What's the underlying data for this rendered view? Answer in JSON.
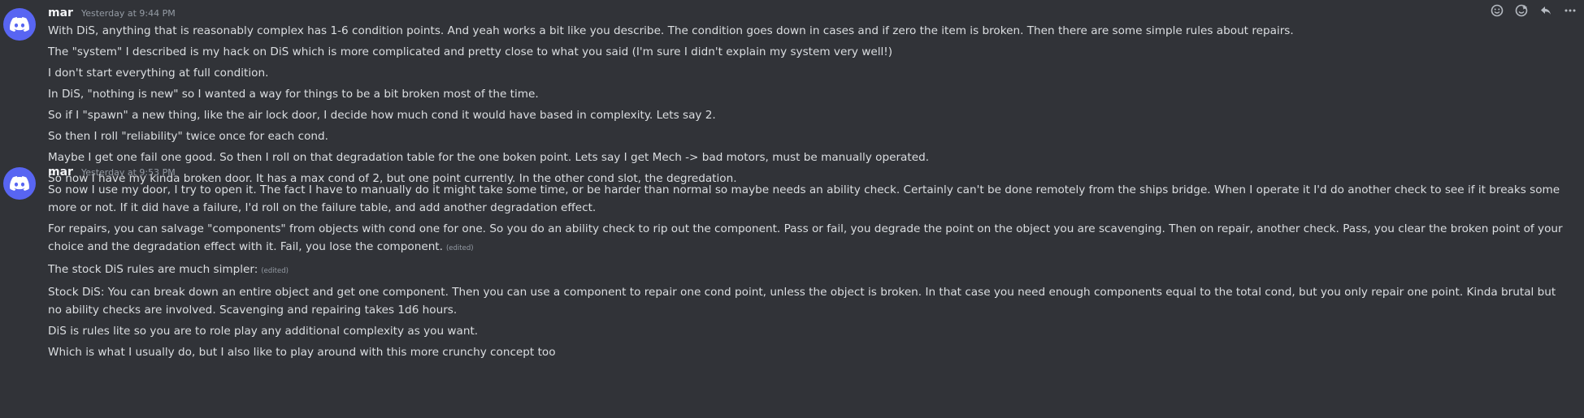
{
  "messages": [
    {
      "author": "mar",
      "timestamp": "Yesterday at 9:44 PM",
      "lines": [
        {
          "text": "With DiS, anything that is reasonably complex has 1-6 condition points. And yeah works a bit like you describe. The condition goes down in cases and if zero the item is broken. Then there are some simple rules about repairs.",
          "edited": ""
        },
        {
          "text": "The \"system\" I described is my hack on DiS which is more complicated and pretty close to what you said (I'm sure I didn't explain my system very well!)",
          "edited": ""
        },
        {
          "text": "I don't start everything at full condition.",
          "edited": ""
        },
        {
          "text": "In DiS, \"nothing is new\" so I wanted a way for things to be a bit broken most of the time.",
          "edited": ""
        },
        {
          "text": "So if I \"spawn\" a new thing, like the air lock door, I decide how much cond it would have based in complexity. Lets say 2.",
          "edited": ""
        },
        {
          "text": "So then I roll \"reliability\" twice once for each cond.",
          "edited": ""
        },
        {
          "text": "Maybe I get one fail one good. So   then I roll on that degradation table for the one boken point. Lets say I get Mech -> bad motors, must be manually operated.",
          "edited": ""
        },
        {
          "text": "So now I have my kinda broken door. It has a max cond of 2, but one point currently. In the other cond slot, the degredation.",
          "edited": ""
        }
      ]
    },
    {
      "author": "mar",
      "timestamp": "Yesterday at 9:53 PM",
      "lines": [
        {
          "text": "So now I use my door, I try to open it. The fact I have to manually do it might take some time, or be harder than normal so maybe needs an ability check. Certainly can't be done remotely from the ships bridge. When I operate it I'd do another check to see if it breaks some more or not. If it did have a failure, I'd roll on the failure table, and add another degradation effect.",
          "edited": ""
        },
        {
          "text": "For repairs,  you can salvage \"components\" from objects with cond one for one. So you do an ability check to rip out the component. Pass or fail, you degrade the point on the object you are scavenging. Then on repair, another check. Pass, you clear the broken point of your choice and the degradation effect with it. Fail, you lose the component.",
          "edited": "(edited)"
        },
        {
          "text": "The stock DiS rules are much simpler:",
          "edited": "(edited)"
        },
        {
          "text": "Stock DiS: You can break down an entire object and get one component. Then you can use a component to repair one cond point, unless the object is broken. In that case you need enough components equal to the total cond, but you only repair one point. Kinda brutal but no ability checks are involved. Scavenging and repairing takes 1d6 hours.",
          "edited": ""
        },
        {
          "text": "DiS is rules lite so you are to role play any additional complexity as you want.",
          "edited": ""
        },
        {
          "text": "Which is what I usually do, but I also like to play around with this more crunchy concept too",
          "edited": ""
        }
      ]
    }
  ],
  "toolbar": {
    "icons": [
      "add-reaction-icon",
      "add-super-reaction-icon",
      "reply-icon",
      "more-icon"
    ]
  },
  "colors": {
    "background": "#313338",
    "avatar": "#5865f2",
    "text": "#dbdee1",
    "muted": "#949ba4"
  }
}
